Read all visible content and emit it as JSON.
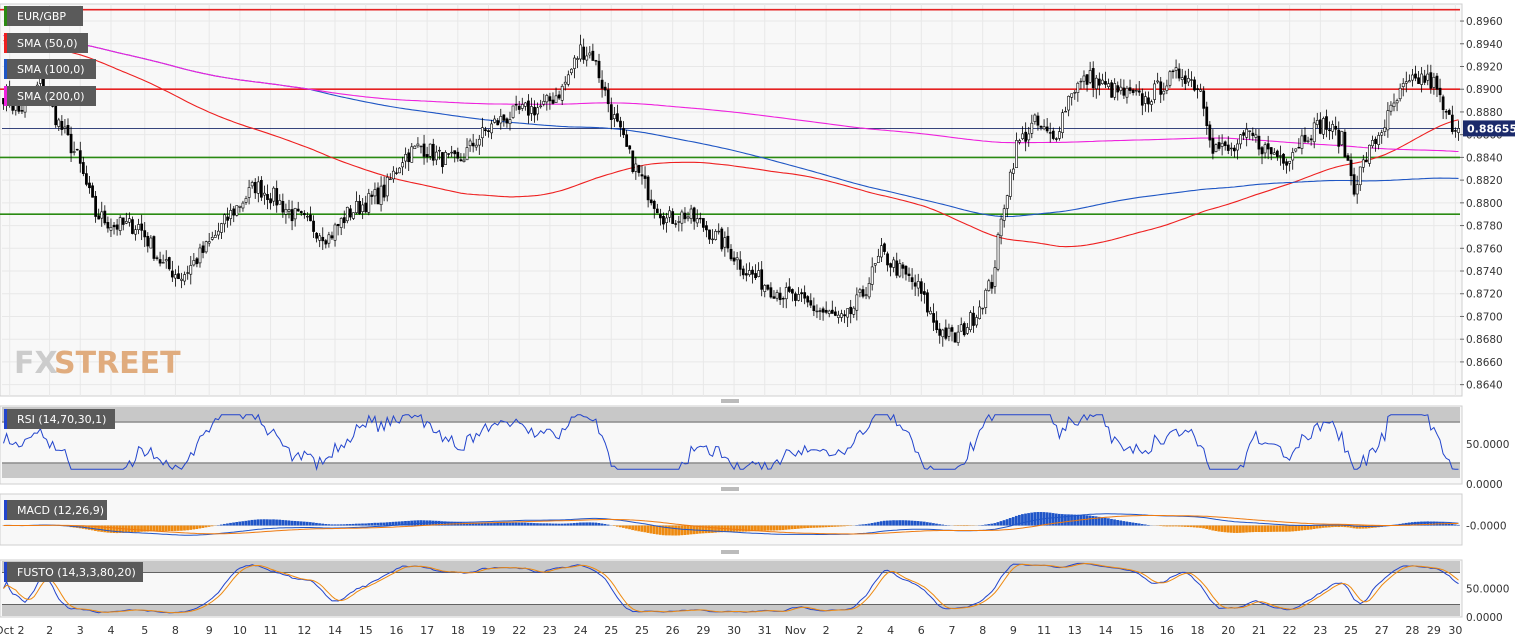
{
  "chart_data": {
    "type": "candlestick",
    "symbol": "EUR/GBP",
    "main_panel": {
      "ylim": [
        0.863,
        0.8975
      ],
      "yticks": [
        "0.8640",
        "0.8660",
        "0.8680",
        "0.8700",
        "0.8720",
        "0.8740",
        "0.8760",
        "0.8780",
        "0.8800",
        "0.8820",
        "0.8840",
        "0.8860",
        "0.8880",
        "0.8900",
        "0.8920",
        "0.8940",
        "0.8960"
      ],
      "last_price": "0.88655",
      "horizontal_levels": [
        {
          "value": 0.897,
          "color": "#e52222"
        },
        {
          "value": 0.89,
          "color": "#e52222"
        },
        {
          "value": 0.884,
          "color": "#2a8a12"
        },
        {
          "value": 0.879,
          "color": "#2a8a12"
        }
      ],
      "indicators": [
        {
          "label": "SMA (50,0)",
          "color": "#ee2020"
        },
        {
          "label": "SMA (100,0)",
          "color": "#1f56c4"
        },
        {
          "label": "SMA (200,0)",
          "color": "#ee22dd"
        }
      ],
      "close_anchors": [
        [
          0,
          0.8895
        ],
        [
          5,
          0.888
        ],
        [
          12,
          0.8905
        ],
        [
          18,
          0.887
        ],
        [
          24,
          0.884
        ],
        [
          30,
          0.879
        ],
        [
          36,
          0.878
        ],
        [
          44,
          0.878
        ],
        [
          52,
          0.8745
        ],
        [
          58,
          0.8735
        ],
        [
          66,
          0.876
        ],
        [
          74,
          0.879
        ],
        [
          82,
          0.8815
        ],
        [
          88,
          0.8805
        ],
        [
          94,
          0.879
        ],
        [
          100,
          0.878
        ],
        [
          106,
          0.877
        ],
        [
          112,
          0.879
        ],
        [
          118,
          0.88
        ],
        [
          124,
          0.881
        ],
        [
          130,
          0.884
        ],
        [
          136,
          0.885
        ],
        [
          142,
          0.884
        ],
        [
          148,
          0.8835
        ],
        [
          154,
          0.8855
        ],
        [
          160,
          0.887
        ],
        [
          168,
          0.888
        ],
        [
          176,
          0.8885
        ],
        [
          182,
          0.89
        ],
        [
          188,
          0.8935
        ],
        [
          192,
          0.893
        ],
        [
          198,
          0.888
        ],
        [
          204,
          0.884
        ],
        [
          210,
          0.881
        ],
        [
          216,
          0.8785
        ],
        [
          222,
          0.879
        ],
        [
          228,
          0.878
        ],
        [
          236,
          0.876
        ],
        [
          242,
          0.874
        ],
        [
          250,
          0.8725
        ],
        [
          258,
          0.8715
        ],
        [
          266,
          0.8705
        ],
        [
          274,
          0.8695
        ],
        [
          280,
          0.872
        ],
        [
          286,
          0.8755
        ],
        [
          292,
          0.874
        ],
        [
          298,
          0.8725
        ],
        [
          304,
          0.869
        ],
        [
          310,
          0.868
        ],
        [
          316,
          0.87
        ],
        [
          322,
          0.873
        ],
        [
          326,
          0.88
        ],
        [
          330,
          0.885
        ],
        [
          336,
          0.887
        ],
        [
          342,
          0.8855
        ],
        [
          348,
          0.89
        ],
        [
          354,
          0.891
        ],
        [
          360,
          0.89
        ],
        [
          366,
          0.8895
        ],
        [
          372,
          0.889
        ],
        [
          378,
          0.8905
        ],
        [
          384,
          0.8915
        ],
        [
          390,
          0.89
        ],
        [
          394,
          0.885
        ],
        [
          400,
          0.8845
        ],
        [
          406,
          0.886
        ],
        [
          412,
          0.8845
        ],
        [
          418,
          0.884
        ],
        [
          424,
          0.886
        ],
        [
          430,
          0.887
        ],
        [
          436,
          0.8855
        ],
        [
          440,
          0.8815
        ],
        [
          444,
          0.884
        ],
        [
          450,
          0.887
        ],
        [
          456,
          0.89
        ],
        [
          462,
          0.891
        ],
        [
          466,
          0.8905
        ],
        [
          470,
          0.8875
        ],
        [
          474,
          0.8865
        ]
      ],
      "bar_count": 475
    },
    "rsi_panel": {
      "label": "RSI (14,70,30,1)",
      "ylim": [
        0,
        100
      ],
      "yticks": [
        "50.0000",
        "0.0000"
      ],
      "levels": [
        70,
        30
      ]
    },
    "macd_panel": {
      "label": "MACD (12,26,9)",
      "yticks": [
        "-0.0000"
      ]
    },
    "fusto_panel": {
      "label": "FUSTO (14,3,3,80,20)",
      "ylim": [
        0,
        100
      ],
      "yticks": [
        "50.0000",
        "0.0000"
      ],
      "levels": [
        80,
        20
      ]
    },
    "x_dates": [
      {
        "label": "Oct 2",
        "bar": 2
      },
      {
        "label": "2",
        "bar": 15
      },
      {
        "label": "3",
        "bar": 25
      },
      {
        "label": "4",
        "bar": 35
      },
      {
        "label": "5",
        "bar": 46
      },
      {
        "label": "8",
        "bar": 56
      },
      {
        "label": "9",
        "bar": 67
      },
      {
        "label": "10",
        "bar": 77
      },
      {
        "label": "11",
        "bar": 87
      },
      {
        "label": "12",
        "bar": 98
      },
      {
        "label": "14",
        "bar": 108
      },
      {
        "label": "15",
        "bar": 118
      },
      {
        "label": "16",
        "bar": 128
      },
      {
        "label": "17",
        "bar": 138
      },
      {
        "label": "18",
        "bar": 148
      },
      {
        "label": "19",
        "bar": 158
      },
      {
        "label": "22",
        "bar": 168
      },
      {
        "label": "23",
        "bar": 178
      },
      {
        "label": "24",
        "bar": 188
      },
      {
        "label": "25",
        "bar": 198
      },
      {
        "label": "25",
        "bar": 208
      },
      {
        "label": "26",
        "bar": 218
      },
      {
        "label": "29",
        "bar": 228
      },
      {
        "label": "30",
        "bar": 238
      },
      {
        "label": "31",
        "bar": 248
      },
      {
        "label": "Nov",
        "bar": 258
      },
      {
        "label": "2",
        "bar": 268
      },
      {
        "label": "2",
        "bar": 279
      },
      {
        "label": "4",
        "bar": 289
      },
      {
        "label": "6",
        "bar": 299
      },
      {
        "label": "7",
        "bar": 309
      },
      {
        "label": "8",
        "bar": 319
      },
      {
        "label": "9",
        "bar": 329
      },
      {
        "label": "11",
        "bar": 339
      },
      {
        "label": "13",
        "bar": 349
      },
      {
        "label": "14",
        "bar": 359
      },
      {
        "label": "15",
        "bar": 369
      },
      {
        "label": "16",
        "bar": 379
      },
      {
        "label": "18",
        "bar": 389
      },
      {
        "label": "20",
        "bar": 399
      },
      {
        "label": "21",
        "bar": 409
      },
      {
        "label": "22",
        "bar": 419
      },
      {
        "label": "23",
        "bar": 429
      },
      {
        "label": "25",
        "bar": 439
      },
      {
        "label": "27",
        "bar": 449
      },
      {
        "label": "28",
        "bar": 459
      },
      {
        "label": "29",
        "bar": 466
      },
      {
        "label": "30",
        "bar": 473
      }
    ]
  },
  "watermark": {
    "fx": "FX",
    "street": "STREET"
  },
  "colors": {
    "bull_fill": "#ffffff",
    "bear_fill": "#000000",
    "grid": "#e8e8e8",
    "panel_band": "#c8c8c8",
    "axis_text": "#333333",
    "tag_bg": "#5a5a5a",
    "watermark": "#e0ac7e"
  }
}
